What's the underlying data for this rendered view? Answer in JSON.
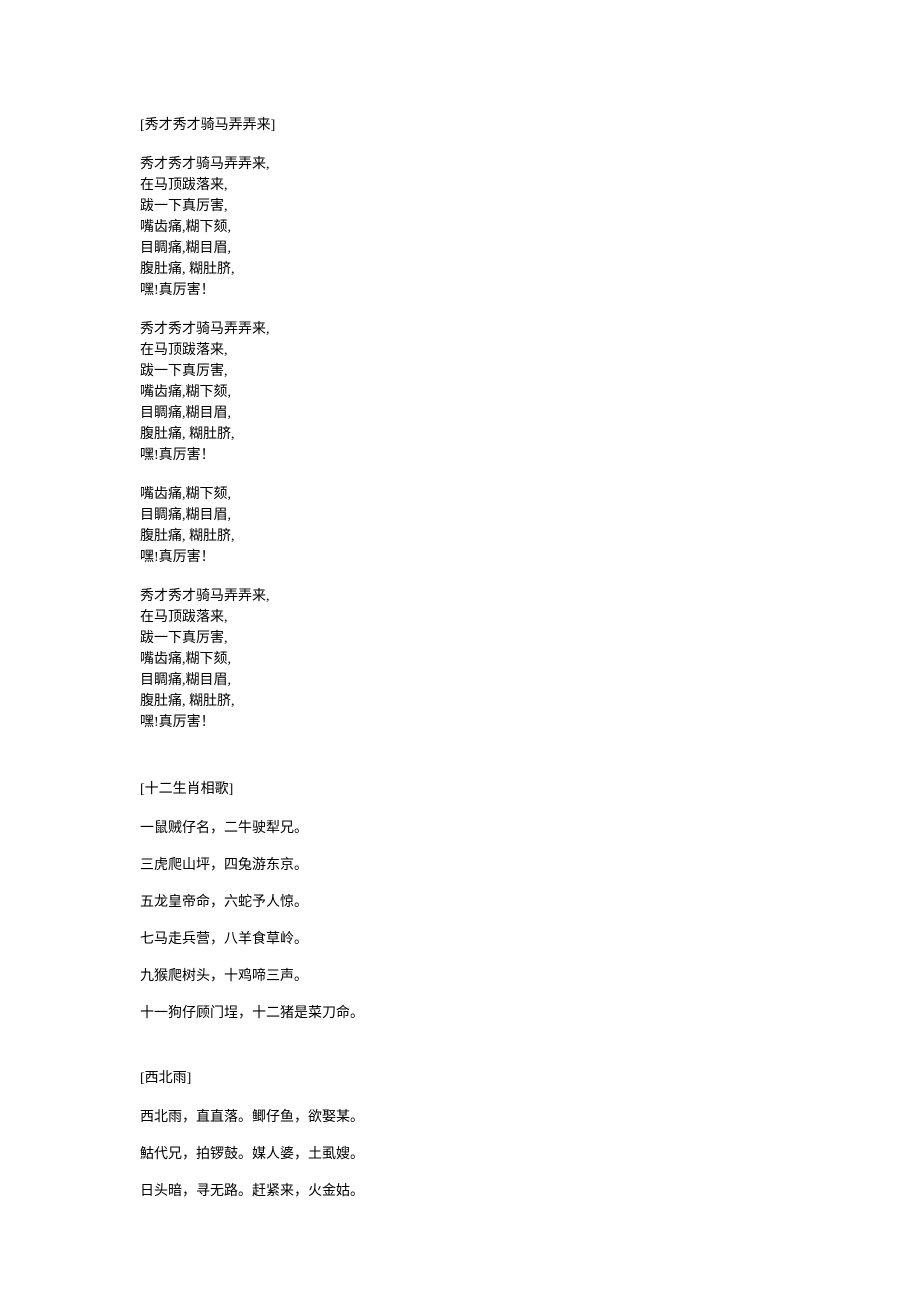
{
  "songs": [
    {
      "title": "[秀才秀才骑马弄弄来]",
      "blocks": [
        {
          "type": "stanza",
          "lines": [
            "秀才秀才骑马弄弄来,",
            "在马顶跋落来,",
            "跋一下真厉害,",
            "嘴齿痛,糊下颏,",
            "目睭痛,糊目眉,",
            "腹肚痛, 糊肚脐,",
            "嘿!真厉害！"
          ]
        },
        {
          "type": "stanza",
          "lines": [
            "秀才秀才骑马弄弄来,",
            "在马顶跋落来,",
            "跋一下真厉害,",
            "嘴齿痛,糊下颏,",
            "目睭痛,糊目眉,",
            "腹肚痛, 糊肚脐,",
            "嘿!真厉害！"
          ]
        },
        {
          "type": "stanza",
          "lines": [
            "嘴齿痛,糊下颏,",
            "目睭痛,糊目眉,",
            "腹肚痛, 糊肚脐,",
            "嘿!真厉害！"
          ]
        },
        {
          "type": "stanza",
          "lines": [
            "秀才秀才骑马弄弄来,",
            "在马顶跋落来,",
            "跋一下真厉害,",
            "嘴齿痛,糊下颏,",
            "目睭痛,糊目眉,",
            "腹肚痛, 糊肚脐,",
            "嘿!真厉害！"
          ]
        }
      ]
    },
    {
      "title": "[十二生肖相歌]",
      "blocks": [
        {
          "type": "prose",
          "text": "一鼠贼仔名，二牛驶犁兄。"
        },
        {
          "type": "prose",
          "text": "三虎爬山坪，四兔游东京。"
        },
        {
          "type": "prose",
          "text": "五龙皇帝命，六蛇予人惊。"
        },
        {
          "type": "prose",
          "text": "七马走兵营，八羊食草岭。"
        },
        {
          "type": "prose",
          "text": "九猴爬树头，十鸡啼三声。"
        },
        {
          "type": "prose",
          "text": "十一狗仔顾门埕，十二猪是菜刀命。"
        }
      ]
    },
    {
      "title": "[西北雨]",
      "blocks": [
        {
          "type": "prose",
          "text": "西北雨，直直落。鲫仔鱼，欲娶某。"
        },
        {
          "type": "prose",
          "text": "鮕代兄，拍锣鼓。媒人婆，土虱嫂。"
        },
        {
          "type": "prose",
          "text": "日头暗，寻无路。赶紧来，火金姑。"
        }
      ]
    }
  ]
}
